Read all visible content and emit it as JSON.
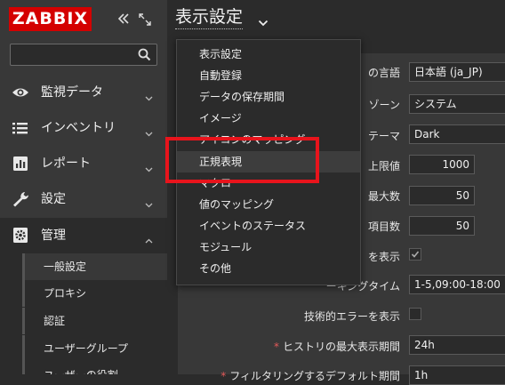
{
  "sidebar": {
    "logo_text": "ZABBIX",
    "search": {
      "placeholder": "",
      "value": ""
    },
    "menu": [
      {
        "id": "monitoring",
        "label": "監視データ",
        "icon": "eye-icon"
      },
      {
        "id": "inventory",
        "label": "インベントリ",
        "icon": "list-icon"
      },
      {
        "id": "reports",
        "label": "レポート",
        "icon": "bar-chart-icon"
      },
      {
        "id": "configuration",
        "label": "設定",
        "icon": "wrench-icon"
      },
      {
        "id": "administration",
        "label": "管理",
        "icon": "gear-icon"
      }
    ],
    "submenu": [
      "一般設定",
      "プロキシ",
      "認証",
      "ユーザーグループ",
      "ユーザーの役割"
    ]
  },
  "header": {
    "title": "表示設定"
  },
  "dropdown": {
    "items": [
      "表示設定",
      "自動登録",
      "データの保存期間",
      "イメージ",
      "アイコンのマッピング",
      "正規表現",
      "マクロ",
      "値のマッピング",
      "イベントのステータス",
      "モジュール",
      "その他"
    ],
    "hovered_index": 5
  },
  "form": {
    "rows": [
      {
        "label": "の言語",
        "value": "日本語 (ja_JP)"
      },
      {
        "label": "ゾーン",
        "value": "システム"
      },
      {
        "label": "テーマ",
        "value": "Dark"
      },
      {
        "label": "上限値",
        "value": "1000"
      },
      {
        "label": "最大数",
        "value": "50"
      },
      {
        "label": "項目数",
        "value": "50"
      },
      {
        "label": "を表示",
        "value": ""
      },
      {
        "label": "ーキングタイム",
        "value": "1-5,09:00-18:00"
      },
      {
        "label": "技術的エラーを表示",
        "value": ""
      },
      {
        "label": "ヒストリの最大表示期間",
        "value": "24h"
      },
      {
        "label": "フィルタリングするデフォルト期間",
        "value": "1h"
      }
    ],
    "checkbox_show_checked": true,
    "checkbox_errors_checked": false
  },
  "colors": {
    "brand": "#d40000",
    "highlight": "#e8141c",
    "required": "#e45959"
  }
}
